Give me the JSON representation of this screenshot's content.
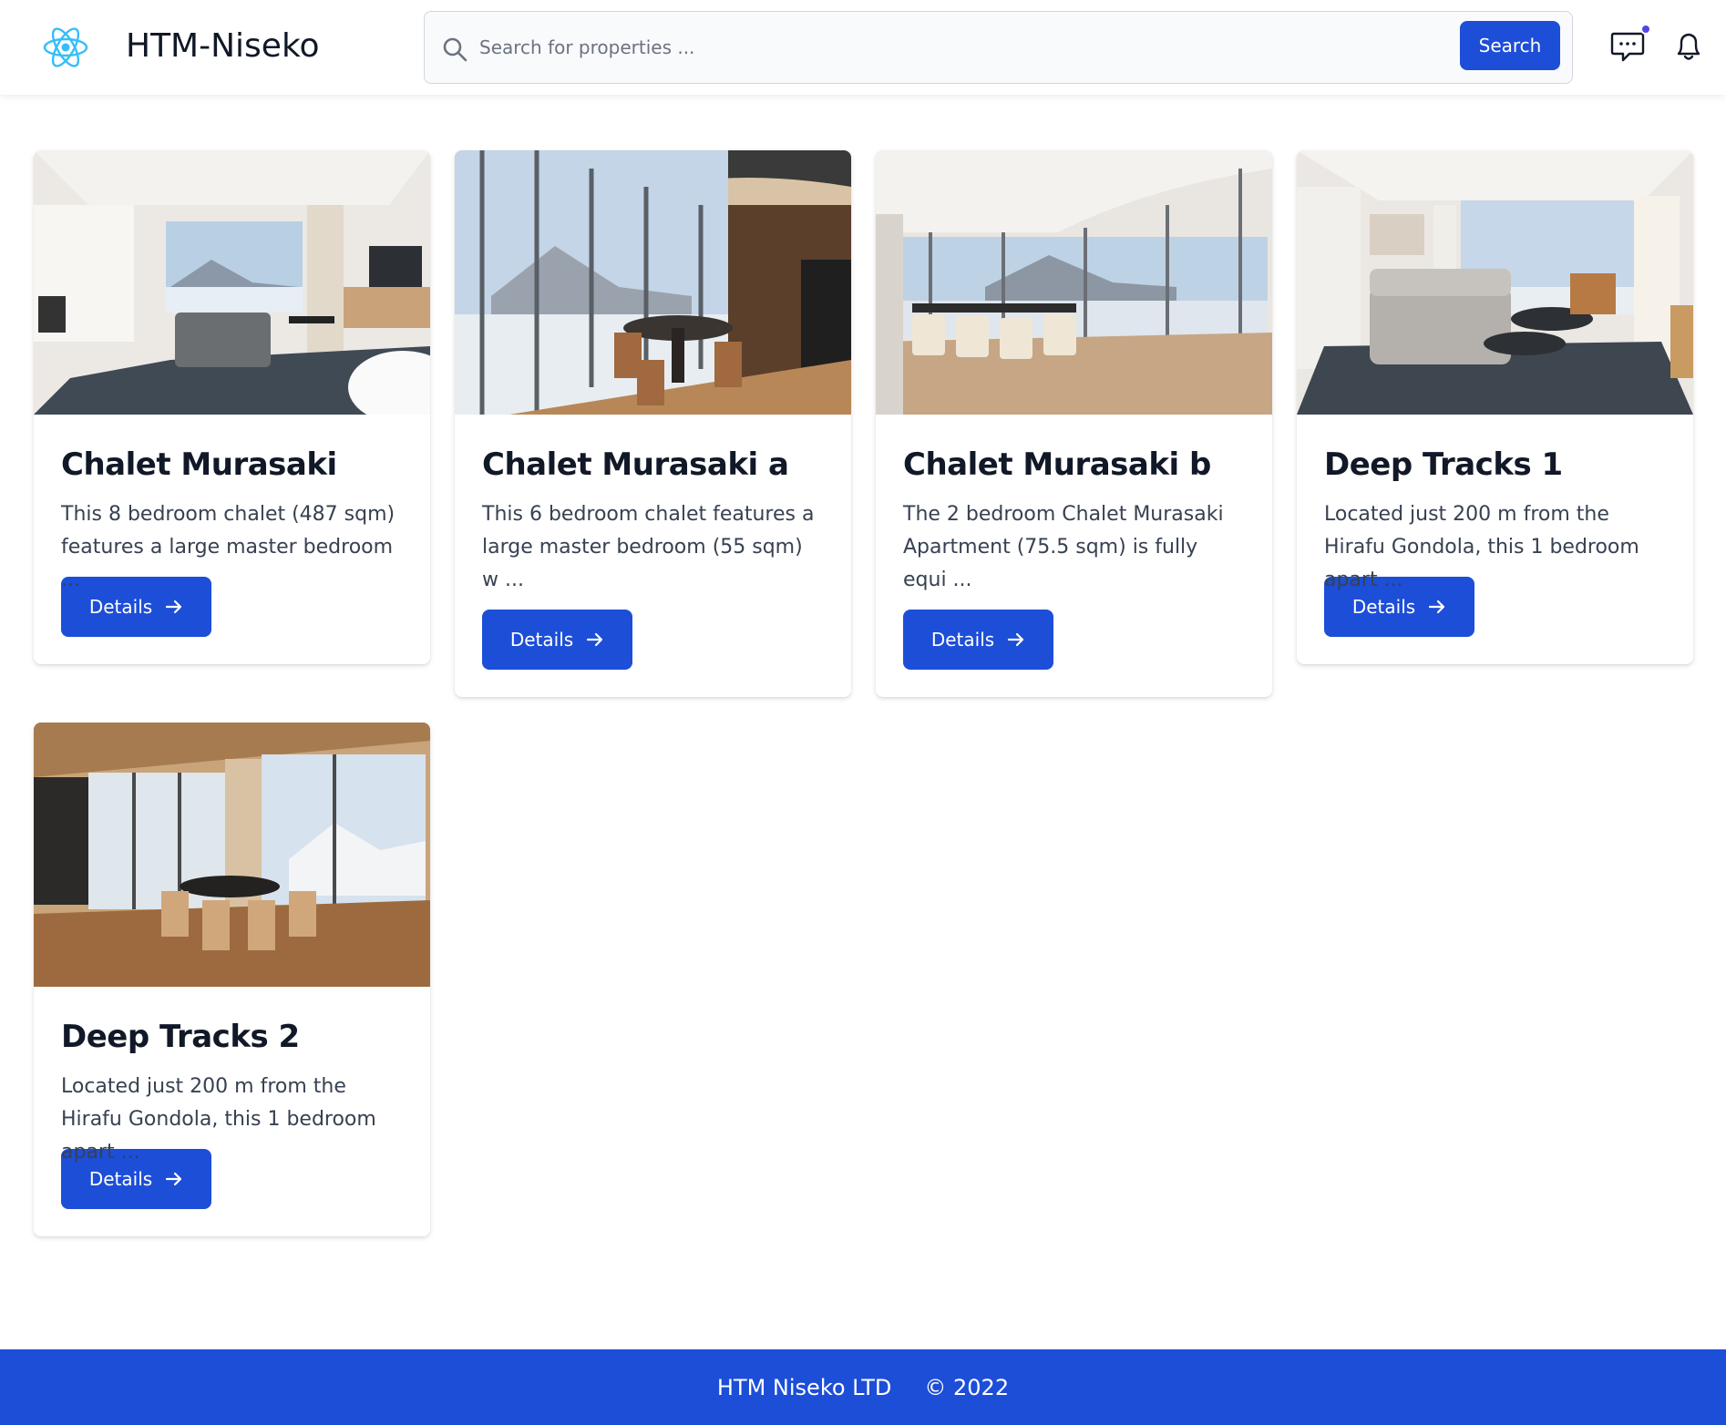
{
  "header": {
    "brand": "HTM-Niseko",
    "search_placeholder": "Search for properties ...",
    "search_button": "Search"
  },
  "listings": [
    {
      "title": "Chalet Murasaki",
      "description": "This 8 bedroom chalet (487 sqm) features a large master bedroom ...",
      "button": "Details"
    },
    {
      "title": "Chalet Murasaki a",
      "description": "This 6 bedroom chalet features a large master bedroom (55 sqm) w ...",
      "button": "Details"
    },
    {
      "title": "Chalet Murasaki b",
      "description": "The 2 bedroom Chalet Murasaki Apartment (75.5 sqm) is fully equi ...",
      "button": "Details"
    },
    {
      "title": "Deep Tracks 1",
      "description": "Located just 200 m from the Hirafu Gondola, this 1 bedroom apart ...",
      "button": "Details"
    },
    {
      "title": "Deep Tracks 2",
      "description": "Located just 200 m from the Hirafu Gondola, this 1 bedroom apart ...",
      "button": "Details"
    }
  ],
  "footer": {
    "company": "HTM Niseko LTD",
    "copyright": "© 2022"
  },
  "colors": {
    "primary": "#1d4ed8",
    "logo": "#38bdf8",
    "notification_dot": "#4f46e5"
  }
}
